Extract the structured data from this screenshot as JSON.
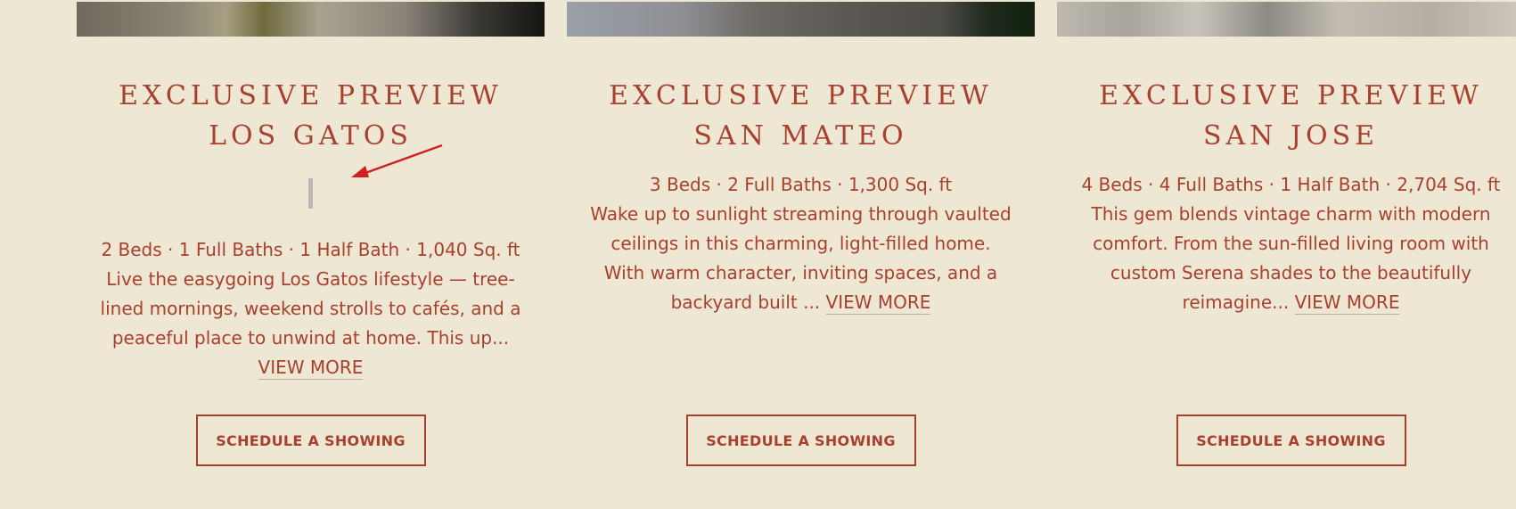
{
  "listings": [
    {
      "title": "EXCLUSIVE PREVIEW LOS GATOS",
      "specs": "2 Beds · 1 Full Baths · 1 Half Bath · 1,040 Sq. ft",
      "description": "Live the easygoing Los Gatos lifestyle — tree-lined mornings, weekend strolls to cafés, and a peaceful place to unwind at home. This up...",
      "view_more": "VIEW MORE",
      "button": "SCHEDULE A SHOWING"
    },
    {
      "title": "EXCLUSIVE PREVIEW SAN MATEO",
      "specs": "3 Beds · 2 Full Baths · 1,300 Sq. ft",
      "description": "Wake up to sunlight streaming through vaulted ceilings in this charming, light-filled home. With warm character, inviting spaces, and a backyard built ...",
      "view_more": "VIEW MORE",
      "button": "SCHEDULE A SHOWING"
    },
    {
      "title": "EXCLUSIVE PREVIEW SAN JOSE",
      "specs": "4 Beds · 4 Full Baths · 1 Half Bath · 2,704 Sq. ft",
      "description": "This gem blends vintage charm with modern comfort. From the sun-filled living room with custom Serena shades to the beautifully reimagine...",
      "view_more": "VIEW MORE",
      "button": "SCHEDULE A SHOWING"
    }
  ],
  "colors": {
    "background": "#ede7d3",
    "accent": "#a8402f",
    "annotation_arrow": "#d21f1f"
  }
}
